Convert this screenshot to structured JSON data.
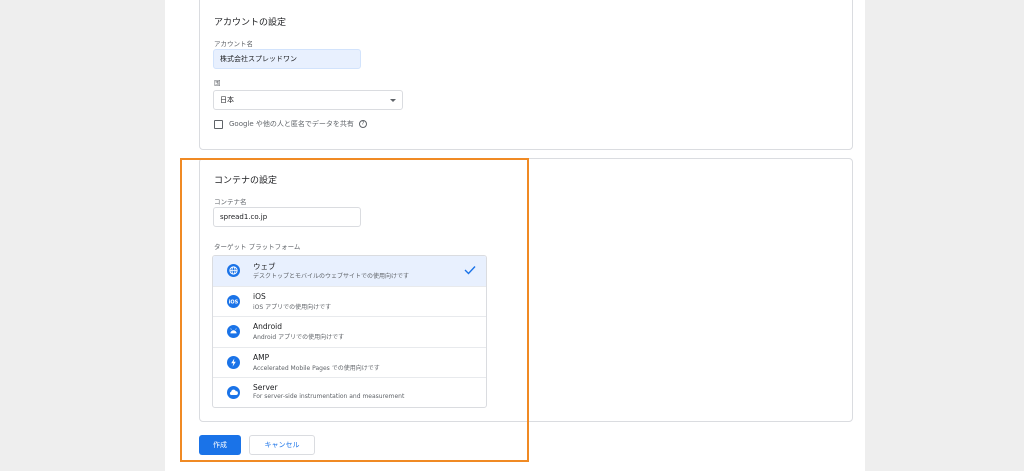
{
  "account": {
    "section_title": "アカウントの設定",
    "name_label": "アカウント名",
    "name_value": "株式会社スプレッドワン",
    "country_label": "国",
    "country_value": "日本",
    "share_label": "Google や他の人と匿名でデータを共有"
  },
  "container": {
    "section_title": "コンテナの設定",
    "name_label": "コンテナ名",
    "name_value": "spread1.co.jp",
    "platform_label": "ターゲット プラットフォーム",
    "platforms": [
      {
        "name": "ウェブ",
        "desc": "デスクトップとモバイルのウェブサイトでの使用向けです",
        "icon": "globe-icon",
        "selected": true
      },
      {
        "name": "iOS",
        "desc": "iOS アプリでの使用向けです",
        "icon": "ios-icon",
        "selected": false
      },
      {
        "name": "Android",
        "desc": "Android アプリでの使用向けです",
        "icon": "android-icon",
        "selected": false
      },
      {
        "name": "AMP",
        "desc": "Accelerated Mobile Pages での使用向けです",
        "icon": "amp-icon",
        "selected": false
      },
      {
        "name": "Server",
        "desc": "For server-side instrumentation and measurement",
        "icon": "cloud-icon",
        "selected": false
      }
    ]
  },
  "actions": {
    "create_label": "作成",
    "cancel_label": "キャンセル"
  },
  "colors": {
    "accent": "#1a73e8",
    "highlight": "#f08a24"
  }
}
